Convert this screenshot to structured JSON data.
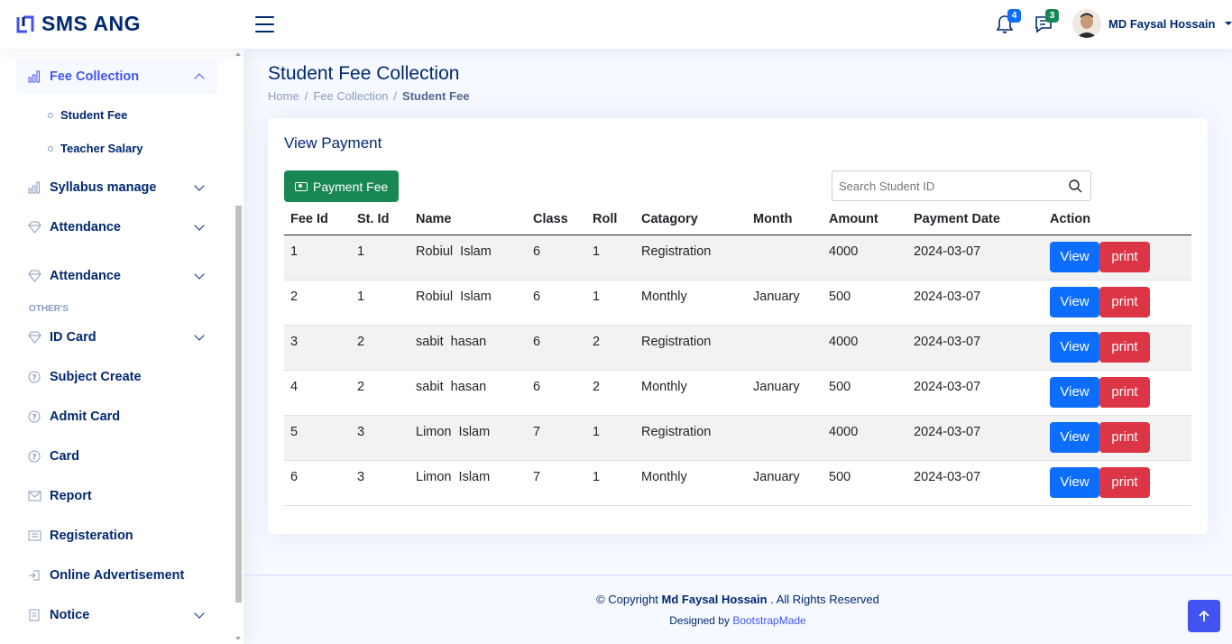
{
  "app": {
    "title": "SMS ANG"
  },
  "header": {
    "notifications_count": "4",
    "messages_count": "3",
    "user_name": "MD Faysal Hossain"
  },
  "sidebar": {
    "fee_collection": "Fee Collection",
    "fee_sub": [
      "Student Fee",
      "Teacher Salary"
    ],
    "syllabus": "Syllabus manage",
    "attendance1": "Attendance",
    "attendance2": "Attendance",
    "heading_others": "OTHER'S",
    "id_card": "ID Card",
    "subject_create": "Subject Create",
    "admit_card": "Admit Card",
    "card": "Card",
    "report": "Report",
    "registration": "Registeration",
    "online_ad": "Online Advertisement",
    "notice": "Notice"
  },
  "page": {
    "title": "Student Fee Collection",
    "breadcrumb": [
      "Home",
      "Fee Collection",
      "Student Fee"
    ]
  },
  "card": {
    "title": "View Payment",
    "pay_button": "Payment Fee",
    "search_placeholder": "Search Student ID"
  },
  "table": {
    "headers": [
      "Fee Id",
      "St. Id",
      "Name",
      "Class",
      "Roll",
      "Catagory",
      "Month",
      "Amount",
      "Payment Date",
      "Action"
    ],
    "rows": [
      [
        "1",
        "1",
        "Robiul  Islam",
        "6",
        "1",
        "Registration",
        "",
        "4000",
        "2024-03-07"
      ],
      [
        "2",
        "1",
        "Robiul  Islam",
        "6",
        "1",
        "Monthly",
        "January",
        "500",
        "2024-03-07"
      ],
      [
        "3",
        "2",
        "sabit  hasan",
        "6",
        "2",
        "Registration",
        "",
        "4000",
        "2024-03-07"
      ],
      [
        "4",
        "2",
        "sabit  hasan",
        "6",
        "2",
        "Monthly",
        "January",
        "500",
        "2024-03-07"
      ],
      [
        "5",
        "3",
        "Limon  Islam",
        "7",
        "1",
        "Registration",
        "",
        "4000",
        "2024-03-07"
      ],
      [
        "6",
        "3",
        "Limon  Islam",
        "7",
        "1",
        "Monthly",
        "January",
        "500",
        "2024-03-07"
      ]
    ],
    "view_label": "View",
    "print_label": "print"
  },
  "footer": {
    "copyright_prefix": "© Copyright",
    "copyright_name": "Md Faysal Hossain",
    "copyright_suffix": ". All Rights Reserved",
    "designed_by": "Designed by",
    "designer": "BootstrapMade"
  }
}
